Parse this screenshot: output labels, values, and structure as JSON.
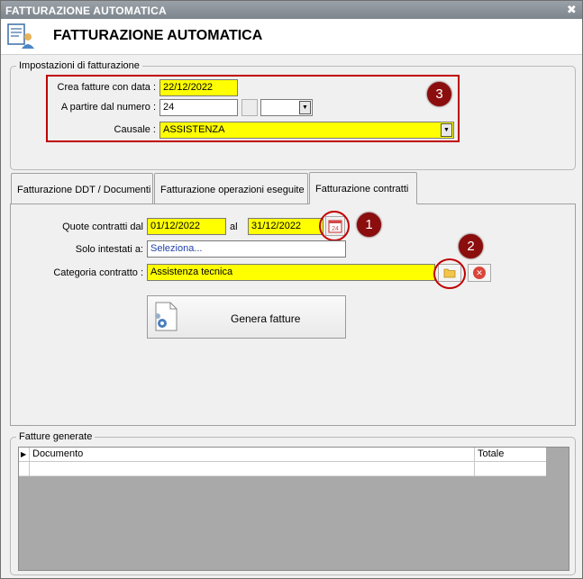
{
  "window": {
    "title": "FATTURAZIONE AUTOMATICA",
    "close_glyph": "✖"
  },
  "header": {
    "title": "FATTURAZIONE AUTOMATICA",
    "icon": "invoice-user-icon"
  },
  "settings": {
    "legend": "Impostazioni di fatturazione",
    "date_label": "Crea fatture con data :",
    "date_value": "22/12/2022",
    "number_label": "A partire dal numero :",
    "number_value": "24",
    "number_suffix_value": "",
    "reason_label": "Causale :",
    "reason_value": "ASSISTENZA",
    "badge": "3"
  },
  "tabs": [
    {
      "label": "Fatturazione DDT / Documenti",
      "active": false
    },
    {
      "label": "Fatturazione operazioni eseguite",
      "active": false
    },
    {
      "label": "Fatturazione contratti",
      "active": true
    }
  ],
  "contracts": {
    "quote_label": "Quote contratti dal",
    "from_value": "01/12/2022",
    "to_label": "al",
    "to_value": "31/12/2022",
    "calendar_icon_text": "24",
    "holders_label": "Solo intestati a:",
    "holders_value": "Seleziona...",
    "category_label": "Categoria contratto :",
    "category_value": "Assistenza tecnica",
    "badge1": "1",
    "badge2": "2",
    "generate_label": "Genera fatture"
  },
  "generated": {
    "legend": "Fatture generate",
    "columns": [
      "Documento",
      "Totale"
    ]
  },
  "colors": {
    "highlight": "#c00000",
    "badge": "#8b0d0d",
    "field_yellow": "#ffff00"
  }
}
